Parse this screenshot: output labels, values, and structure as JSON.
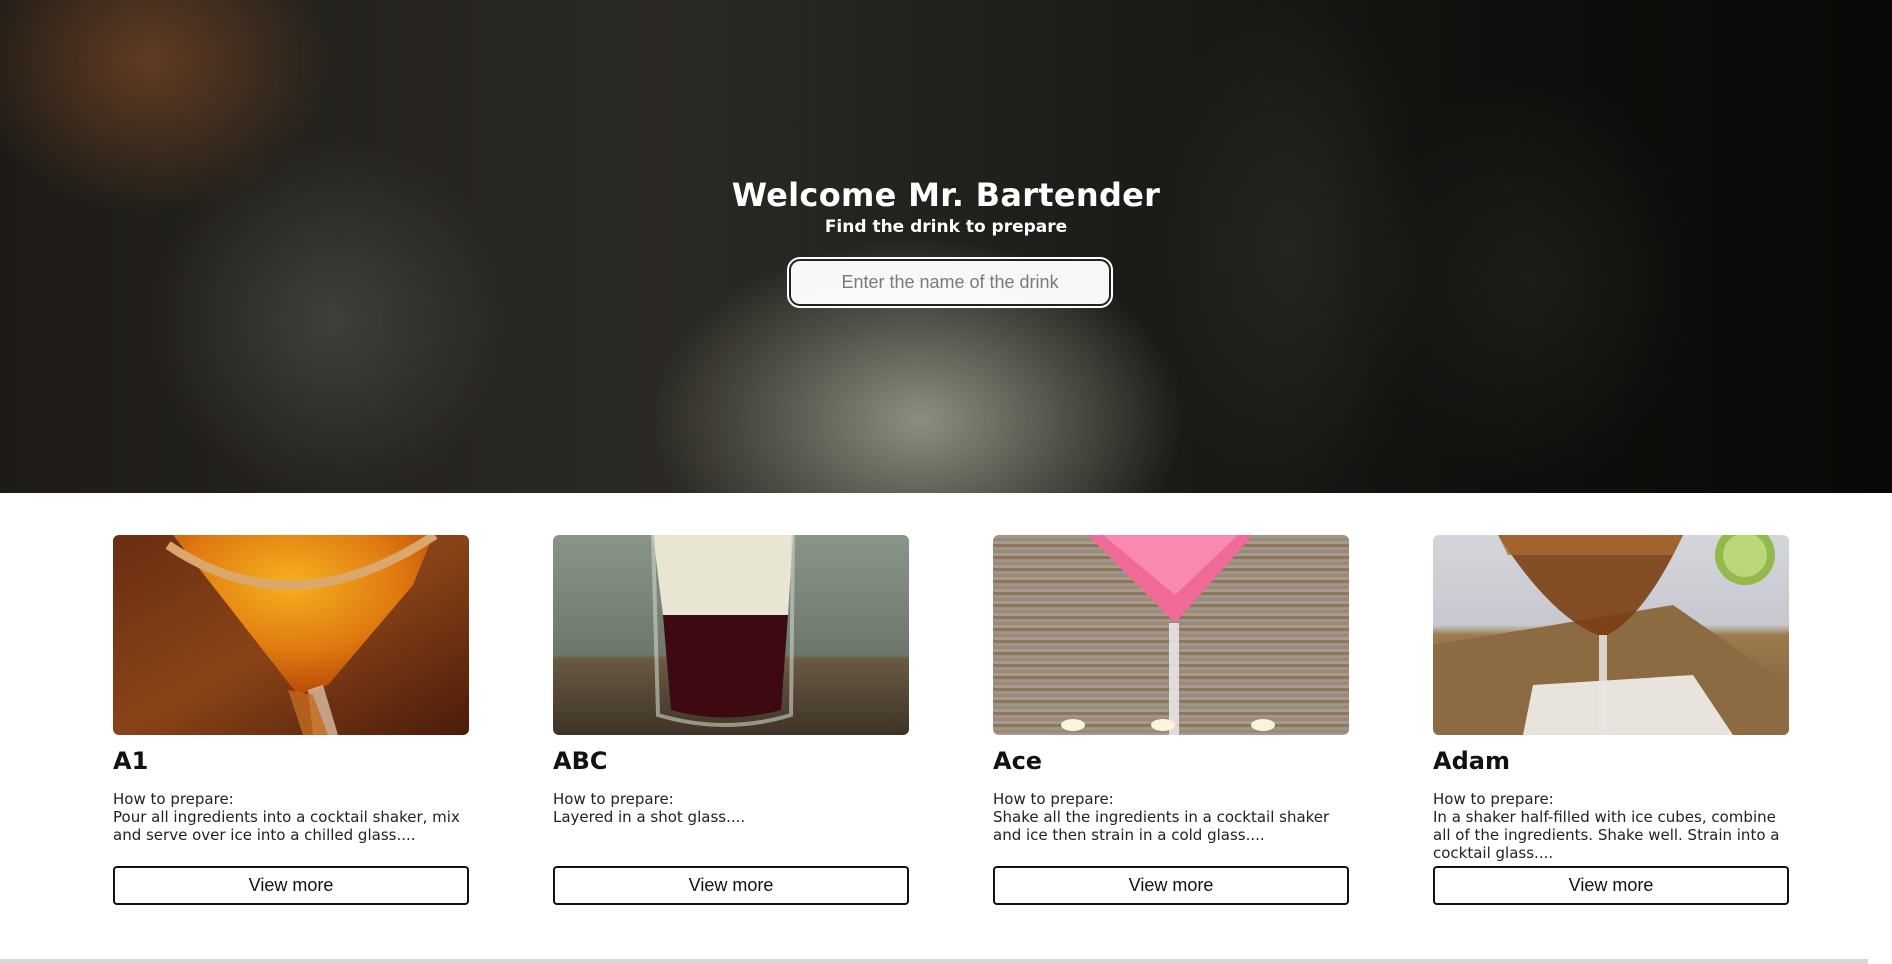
{
  "hero": {
    "title": "Welcome Mr. Bartender",
    "subtitle": "Find the drink to prepare",
    "search_placeholder": "Enter the name of the drink"
  },
  "cards": [
    {
      "name": "A1",
      "howto_label": "How to prepare:",
      "instructions": "Pour all ingredients into a cocktail shaker, mix and serve over ice into a chilled glass....",
      "button_label": "View more",
      "image_icon": "orange-cocktail-glass-photo"
    },
    {
      "name": "ABC",
      "howto_label": "How to prepare:",
      "instructions": "Layered in a shot glass....",
      "button_label": "View more",
      "image_icon": "layered-shot-glass-photo"
    },
    {
      "name": "Ace",
      "howto_label": "How to prepare:",
      "instructions": "Shake all the ingredients in a cocktail shaker and ice then strain in a cold glass....",
      "button_label": "View more",
      "image_icon": "pink-martini-glass-photo"
    },
    {
      "name": "Adam",
      "howto_label": "How to prepare:",
      "instructions": "In a shaker half-filled with ice cubes, combine all of the ingredients. Shake well. Strain into a cocktail glass....",
      "button_label": "View more",
      "image_icon": "amber-martini-lime-photo"
    }
  ]
}
